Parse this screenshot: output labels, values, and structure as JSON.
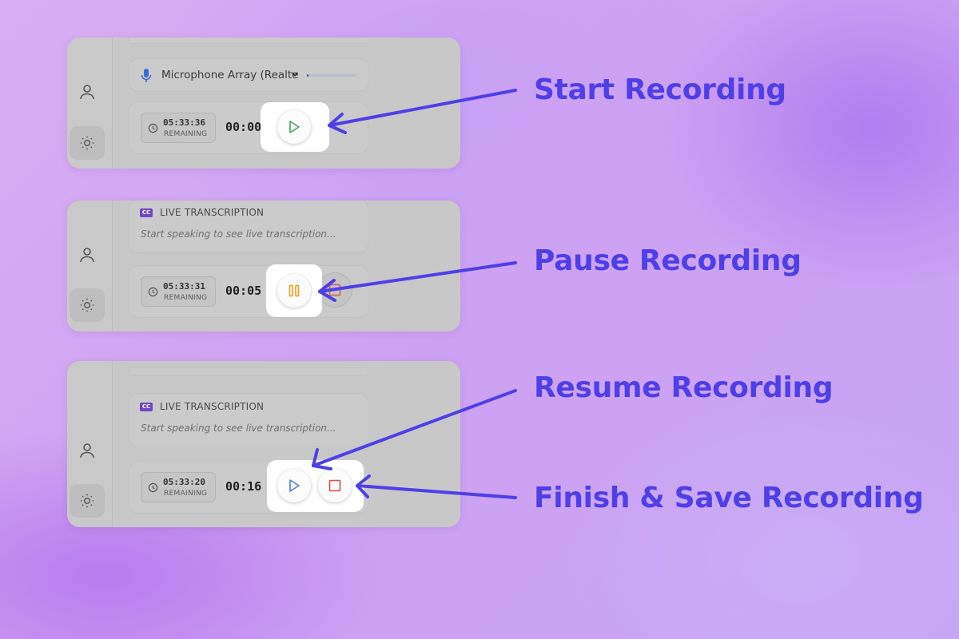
{
  "colors": {
    "accent": "#4e3fe6",
    "play_green": "#3aa85c",
    "pause_orange": "#e8a21a",
    "resume_blue": "#4a7fd6",
    "stop_red": "#e04848",
    "cc_badge": "#7046c8"
  },
  "panels": [
    {
      "microphone": {
        "label": "Microphone Array (Realte",
        "level_fraction": 0.03
      },
      "timer": {
        "remaining": "05:33:36",
        "remaining_label": "REMAINING",
        "elapsed": "00:00"
      },
      "buttons": [
        "play-icon"
      ]
    },
    {
      "transcription": {
        "badge": "CC",
        "title": "LIVE TRANSCRIPTION",
        "hint": "Start speaking to see live transcription..."
      },
      "timer": {
        "remaining": "05:33:31",
        "remaining_label": "REMAINING",
        "elapsed": "00:05"
      },
      "buttons": [
        "pause-icon",
        "stop-icon"
      ]
    },
    {
      "transcription": {
        "badge": "CC",
        "title": "LIVE TRANSCRIPTION",
        "hint": "Start speaking to see live transcription..."
      },
      "timer": {
        "remaining": "05:33:20",
        "remaining_label": "REMAINING",
        "elapsed": "00:16"
      },
      "buttons": [
        "resume-icon",
        "stop-icon"
      ]
    }
  ],
  "callouts": {
    "start": "Start Recording",
    "pause": "Pause Recording",
    "resume": "Resume Recording",
    "finish": "Finish & Save Recording"
  },
  "rail_icons": [
    "user-icon",
    "sun-icon"
  ]
}
